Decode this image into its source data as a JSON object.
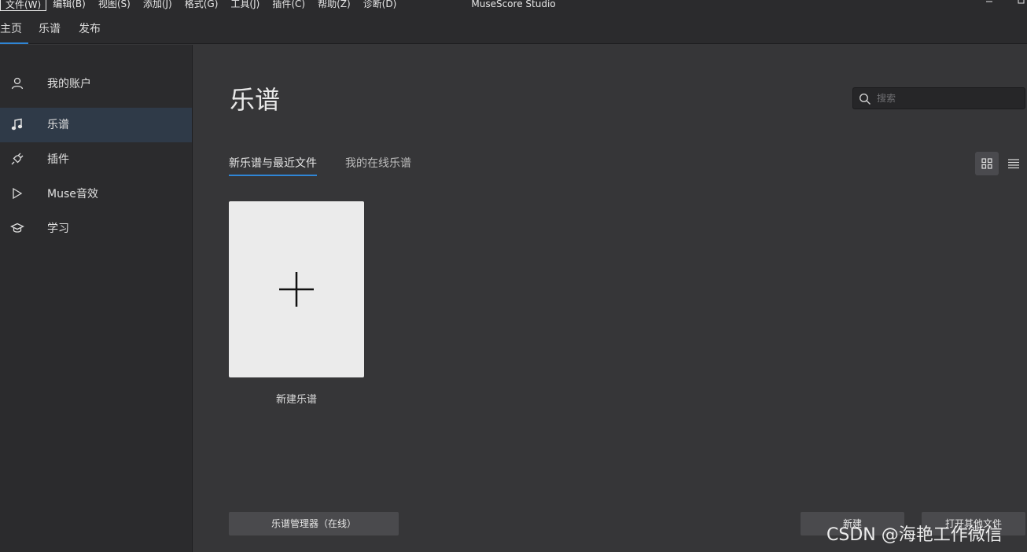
{
  "titlebar": {
    "menu": [
      "文件(W)",
      "编辑(B)",
      "视图(S)",
      "添加(J)",
      "格式(G)",
      "工具(J)",
      "插件(C)",
      "帮助(Z)",
      "诊断(D)"
    ],
    "app_title": "MuseScore Studio",
    "minimize_icon": "minimize-icon",
    "restore_icon": "restore-icon"
  },
  "tabs": [
    "主页",
    "乐谱",
    "发布"
  ],
  "sidebar": {
    "items": [
      {
        "label": "我的账户",
        "icon": "user-icon"
      },
      {
        "label": "乐谱",
        "icon": "music-note-icon"
      },
      {
        "label": "插件",
        "icon": "plug-icon"
      },
      {
        "label": "Muse音效",
        "icon": "play-icon"
      },
      {
        "label": "学习",
        "icon": "graduation-cap-icon"
      }
    ],
    "active_index": 1
  },
  "main": {
    "title": "乐谱",
    "search": {
      "placeholder": "搜索",
      "value": ""
    },
    "subtabs": [
      "新乐谱与最近文件",
      "我的在线乐谱"
    ],
    "view_modes": [
      "grid-view-icon",
      "list-view-icon"
    ],
    "new_score_label": "新建乐谱"
  },
  "footer": {
    "score_manager_button": "乐谱管理器（在线）",
    "new_button": "新建",
    "open_other_button": "打开其他文件"
  },
  "watermark": "CSDN @海艳工作微信",
  "colors": {
    "accent": "#2f86d6",
    "sidebar_bg": "#2b2b2d",
    "main_bg": "#363638",
    "card_bg": "#ebebeb",
    "active_sidebar_bg": "#2f3a48"
  }
}
